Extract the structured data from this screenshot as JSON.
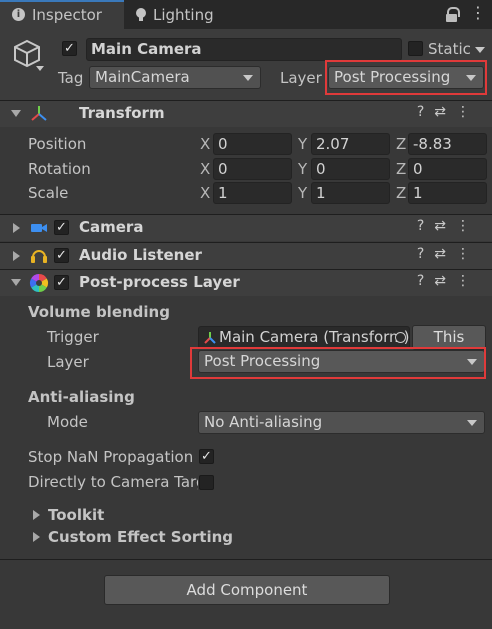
{
  "tabs": [
    {
      "label": "Inspector",
      "icon": "info-icon",
      "active": true
    },
    {
      "label": "Lighting",
      "icon": "lightbulb-icon",
      "active": false
    }
  ],
  "header": {
    "object_name": "Main Camera",
    "active_checked": true,
    "static_label": "Static",
    "static_checked": false,
    "tag_label": "Tag",
    "tag_value": "MainCamera",
    "layer_label": "Layer",
    "layer_value": "Post Processing"
  },
  "transform": {
    "title": "Transform",
    "rows": [
      {
        "label": "Position",
        "x": "0",
        "y": "2.07",
        "z": "-8.83"
      },
      {
        "label": "Rotation",
        "x": "0",
        "y": "0",
        "z": "0"
      },
      {
        "label": "Scale",
        "x": "1",
        "y": "1",
        "z": "1"
      }
    ],
    "axes": [
      "X",
      "Y",
      "Z"
    ]
  },
  "components": [
    {
      "title": "Camera",
      "checked": true,
      "icon": "camera-icon"
    },
    {
      "title": "Audio Listener",
      "checked": true,
      "icon": "headphones-icon"
    },
    {
      "title": "Post-process Layer",
      "checked": true,
      "icon": "color-wheel-icon"
    }
  ],
  "postprocess": {
    "volume_blending_label": "Volume blending",
    "trigger_label": "Trigger",
    "trigger_value": "Main Camera (Transform)",
    "this_button": "This",
    "layer_label": "Layer",
    "layer_value": "Post Processing",
    "anti_aliasing_label": "Anti-aliasing",
    "mode_label": "Mode",
    "mode_value": "No Anti-aliasing",
    "stop_nan_label": "Stop NaN Propagation",
    "stop_nan_checked": true,
    "direct_target_label": "Directly to Camera Target",
    "direct_target_checked": false,
    "toolkit_label": "Toolkit",
    "custom_sorting_label": "Custom Effect Sorting"
  },
  "add_component_label": "Add Component",
  "colors": {
    "background": "#383838",
    "highlight_box": "#e03a3a",
    "field": "#2a2a2a"
  }
}
